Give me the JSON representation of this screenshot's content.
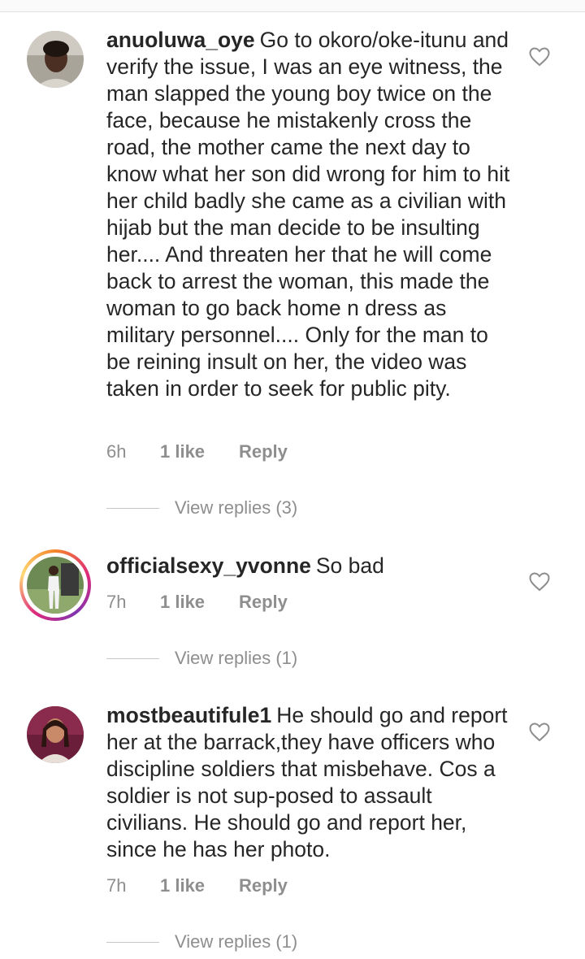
{
  "comments": [
    {
      "username": "anuoluwa_oye",
      "text": "Go to okoro/oke-itunu and verify the issue, I was an eye witness, the man slapped the young boy twice on the face, because he mistakenly cross the road, the mother came the next day to know what her son did wrong for him to hit her child badly she came as a civilian with hijab but the man decide to be insulting her.... And threaten her that he will come back to arrest the woman, this made the woman to go back home n dress as military personnel.... Only for the man to be reining insult on her, the video was taken in order to seek for public pity.",
      "time": "6h",
      "likes": "1 like",
      "reply": "Reply",
      "view_replies": "View replies (3)"
    },
    {
      "username": "officialsexy_yvonne",
      "text": "So bad",
      "time": "7h",
      "likes": "1 like",
      "reply": "Reply",
      "view_replies": "View replies (1)"
    },
    {
      "username": "mostbeautifule1",
      "text": "He should go and report her at the barrack,they have officers who discipline soldiers that misbehave. Cos a soldier is not sup-posed to assault civilians. He should go and report her, since he has her photo.",
      "time": "7h",
      "likes": "1 like",
      "reply": "Reply",
      "view_replies": "View replies (1)"
    }
  ],
  "icons": {
    "like": "heart-outline-icon"
  },
  "colors": {
    "text": "#262626",
    "secondary": "#8e8e8e"
  }
}
